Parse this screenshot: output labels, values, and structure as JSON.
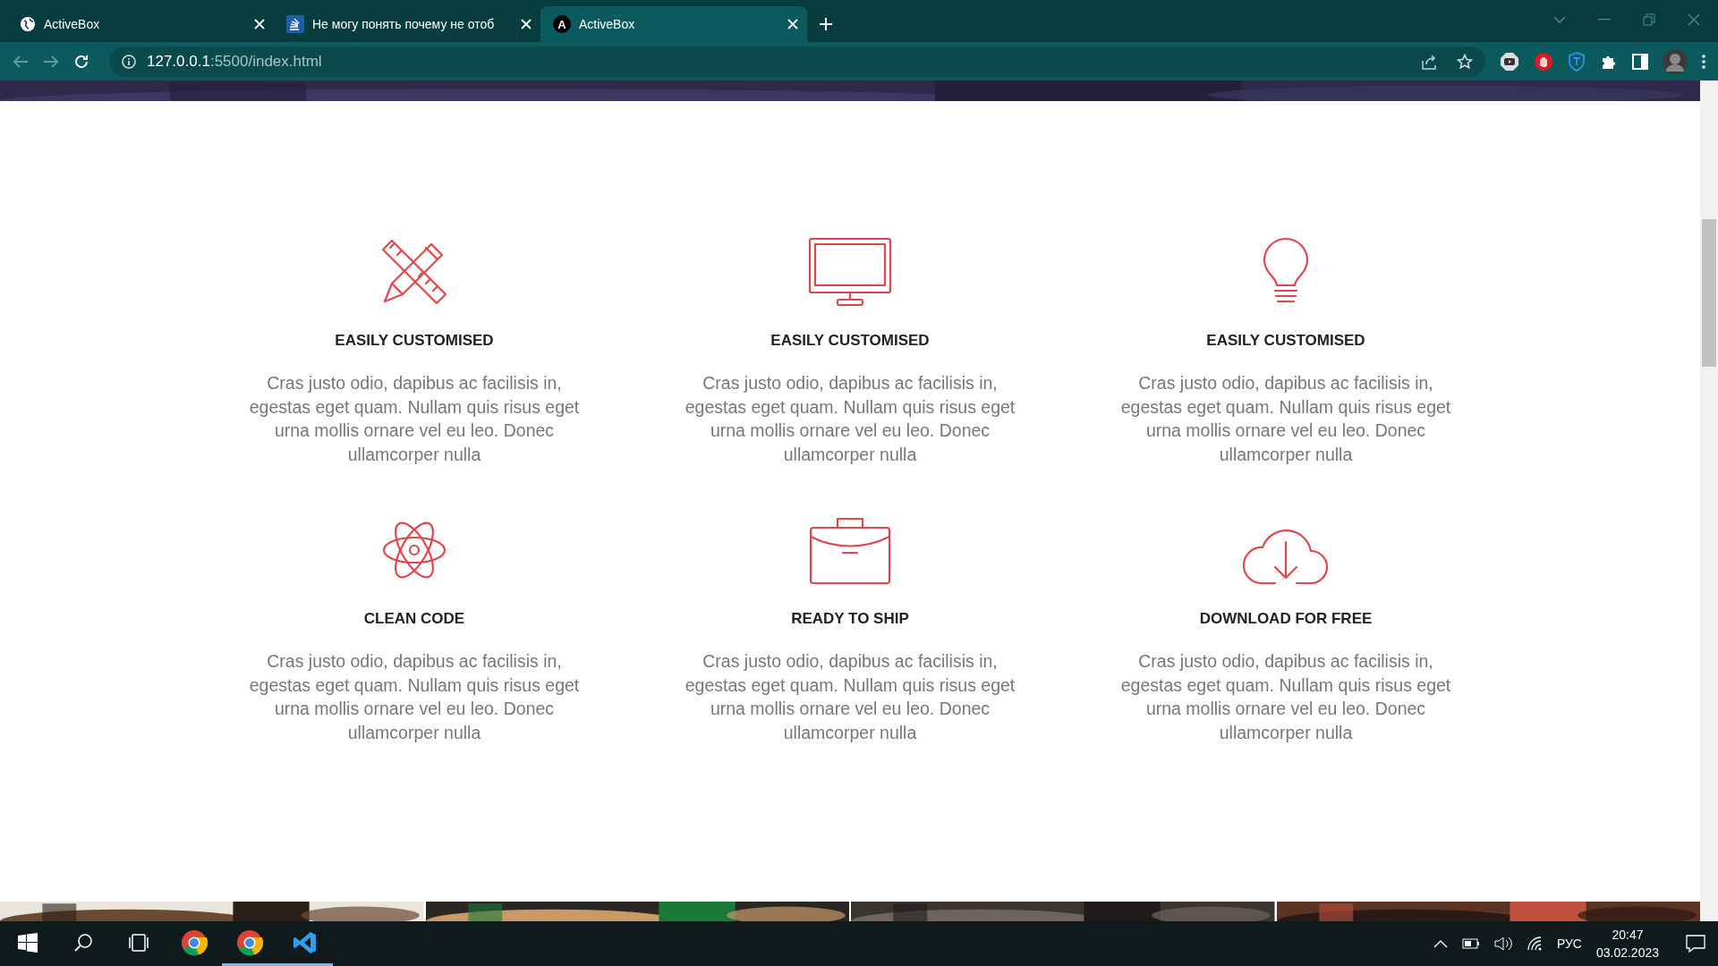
{
  "browser": {
    "tabs": [
      {
        "title": "ActiveBox",
        "kind": "globe",
        "selected": false
      },
      {
        "title": "Не могу понять почему не отоб",
        "kind": "stack",
        "selected": false
      },
      {
        "title": "ActiveBox",
        "kind": "letter",
        "letter": "A",
        "selected": true
      }
    ],
    "url_host": "127.0.0.1",
    "url_path": ":5500/index.html"
  },
  "features": [
    {
      "kind": "pencil-ruler",
      "title": "EASILY CUSTOMISED",
      "text": "Cras justo odio, dapibus ac facilisis in, egestas eget quam. Nullam quis risus eget urna mollis ornare vel eu leo. Donec ullamcorper nulla"
    },
    {
      "kind": "monitor",
      "title": "EASILY CUSTOMISED",
      "text": "Cras justo odio, dapibus ac facilisis in, egestas eget quam. Nullam quis risus eget urna mollis ornare vel eu leo. Donec ullamcorper nulla"
    },
    {
      "kind": "bulb",
      "title": "EASILY CUSTOMISED",
      "text": "Cras justo odio, dapibus ac facilisis in, egestas eget quam. Nullam quis risus eget urna mollis ornare vel eu leo. Donec ullamcorper nulla"
    },
    {
      "kind": "atom",
      "title": "CLEAN CODE",
      "text": "Cras justo odio, dapibus ac facilisis in, egestas eget quam. Nullam quis risus eget urna mollis ornare vel eu leo. Donec ullamcorper nulla"
    },
    {
      "kind": "briefcase",
      "title": "READY TO SHIP",
      "text": "Cras justo odio, dapibus ac facilisis in, egestas eget quam. Nullam quis risus eget urna mollis ornare vel eu leo. Donec ullamcorper nulla"
    },
    {
      "kind": "cloud",
      "title": "DOWNLOAD FOR FREE",
      "text": "Cras justo odio, dapibus ac facilisis in, egestas eget quam. Nullam quis risus eget urna mollis ornare vel eu leo. Donec ullamcorper nulla"
    }
  ],
  "taskbar": {
    "apps": [
      {
        "kind": "chrome",
        "active": false
      },
      {
        "kind": "chrome",
        "active": true
      },
      {
        "kind": "vscode",
        "active": true
      }
    ],
    "language": "РУС",
    "time": "20:47",
    "date": "03.02.2023"
  }
}
